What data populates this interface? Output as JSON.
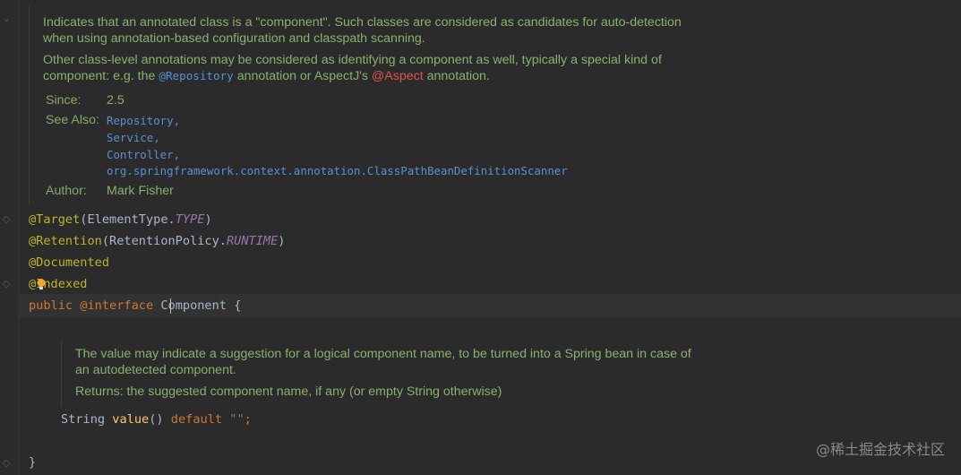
{
  "javadoc": {
    "para1": "Indicates that an annotated class is a \"component\". Such classes are considered as candidates for auto-detection when using annotation-based configuration and classpath scanning.",
    "para2_a": "Other class-level annotations may be considered as identifying a component as well, typically a special kind of component: e.g. the ",
    "para2_link1": "@Repository",
    "para2_b": " annotation or AspectJ's ",
    "para2_link2": "@Aspect",
    "para2_c": " annotation.",
    "since_label": "Since:",
    "since_value": "2.5",
    "see_also_label": "See Also:",
    "see_also": [
      "Repository,",
      "Service,",
      "Controller,",
      "org.springframework.context.annotation.ClassPathBeanDefinitionScanner"
    ],
    "author_label": "Author:",
    "author_value": "Mark Fisher"
  },
  "code": {
    "line1_anno": "@Target",
    "line1_rest": "(ElementType.",
    "line1_const": "TYPE",
    "line1_close": ")",
    "line2_anno": "@Retention",
    "line2_rest": "(RetentionPolicy.",
    "line2_const": "RUNTIME",
    "line2_close": ")",
    "line3": "@Documented",
    "line4": "@Indexed",
    "line5_kw1": "public",
    "line5_kw2": "@interface",
    "line5_name": "Component",
    "line5_brace": "{",
    "method_type": "String",
    "method_name": "value",
    "method_parens": "()",
    "method_kw": "default",
    "method_str": "\"\"",
    "method_semi": ";",
    "close_brace": "}"
  },
  "method_doc": {
    "para": "The value may indicate a suggestion for a logical component name, to be turned into a Spring bean in case of an autodetected component.",
    "returns": "Returns: the suggested component name, if any (or empty String otherwise)"
  },
  "watermark": "@稀土掘金技术社区",
  "colors": {
    "background": "#2b2b2b",
    "doc_text": "#8ab06e",
    "annotation": "#bbb529",
    "keyword": "#cc7832",
    "link": "#5b8fd4"
  }
}
